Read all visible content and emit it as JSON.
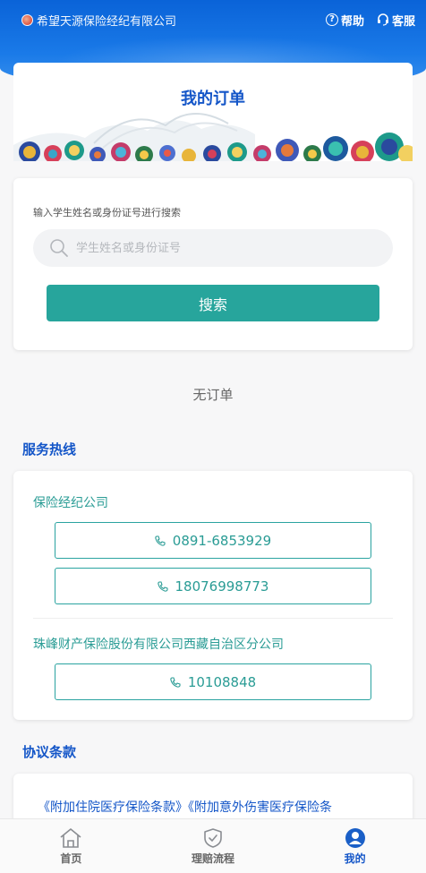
{
  "header": {
    "brand": "希望天源保险经纪有限公司",
    "help": "帮助",
    "service": "客服"
  },
  "order": {
    "title": "我的订单"
  },
  "search": {
    "hint": "输入学生姓名或身份证号进行搜索",
    "placeholder": "学生姓名或身份证号",
    "button": "搜索"
  },
  "empty_text": "无订单",
  "hotline": {
    "title": "服务热线",
    "companies": [
      {
        "name": "保险经纪公司",
        "phones": [
          "0891-6853929",
          "18076998773"
        ]
      },
      {
        "name": "珠峰财产保险股份有限公司西藏自治区分公司",
        "phones": [
          "10108848"
        ]
      }
    ]
  },
  "terms": {
    "title": "协议条款",
    "text": "《附加住院医疗保险条款》《附加意外伤害医疗保险条"
  },
  "nav": {
    "items": [
      {
        "label": "首页",
        "icon": "home-icon"
      },
      {
        "label": "理赔流程",
        "icon": "shield-check-icon"
      },
      {
        "label": "我的",
        "icon": "user-icon"
      }
    ],
    "active_index": 2
  },
  "colors": {
    "primary_blue": "#1456c8",
    "header_blue": "#0a63d8",
    "teal": "#27a59c"
  }
}
